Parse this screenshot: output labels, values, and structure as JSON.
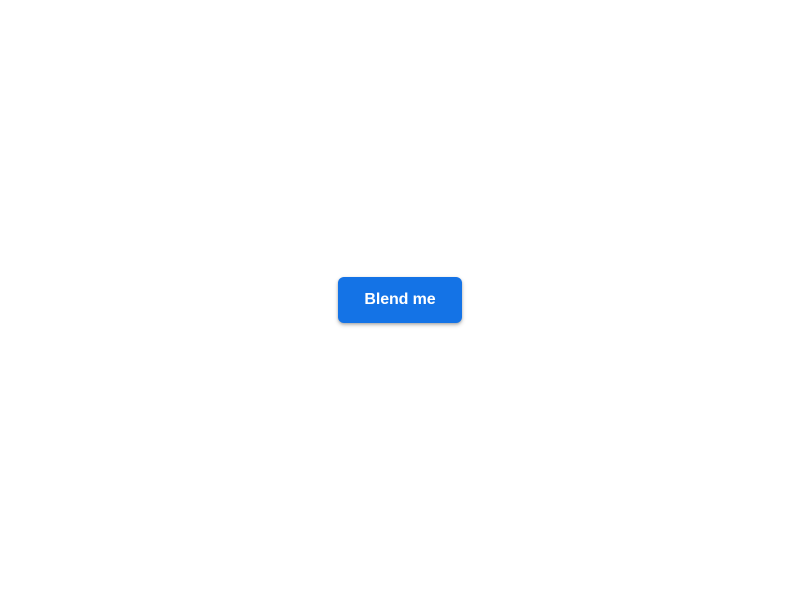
{
  "button": {
    "label": "Blend me"
  }
}
